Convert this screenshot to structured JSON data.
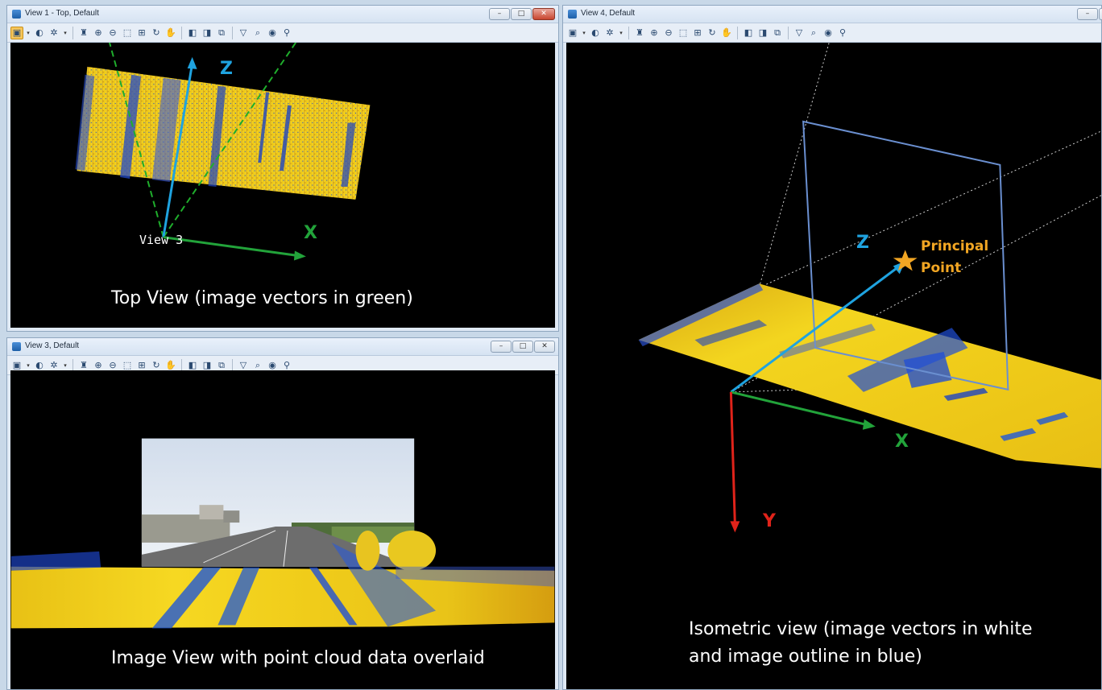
{
  "windows": {
    "view1": {
      "title": "View 1 - Top, Default"
    },
    "view3": {
      "title": "View 3, Default"
    },
    "view4": {
      "title": "View 4, Default"
    }
  },
  "window_buttons": {
    "minimize": "–",
    "maximize": "□",
    "close": "✕"
  },
  "toolbar_icons": [
    "view-groups-icon",
    "dropdown-icon",
    "display-style-icon",
    "lighting-icon",
    "dropdown-icon",
    "view-attributes-icon",
    "zoom-in-icon",
    "zoom-out-icon",
    "window-area-icon",
    "fit-view-icon",
    "rotate-view-icon",
    "pan-view-icon",
    "view-previous-icon",
    "view-next-icon",
    "copy-view-icon",
    "clip-volume-icon",
    "clip-mask-icon",
    "camera-icon",
    "walk-icon"
  ],
  "top_view": {
    "label_z": "Z",
    "label_x": "X",
    "label_view": "View 3",
    "caption": "Top View (image vectors in green)"
  },
  "image_view": {
    "caption": "Image View with point cloud data overlaid"
  },
  "iso_view": {
    "label_z": "Z",
    "label_x": "X",
    "label_y": "Y",
    "principal_point_line1": "Principal",
    "principal_point_line2": "Point",
    "caption_line1": "Isometric view (image vectors in white",
    "caption_line2": "and image outline in blue)"
  },
  "colors": {
    "axis_z": "#1fa3e0",
    "axis_x": "#22a33a",
    "axis_y": "#e0231a",
    "image_vector_top": "#1fae2c",
    "image_outline": "#6a8fd0",
    "principal_point": "#f2a623",
    "point_cloud_yellow": "#f2d21a",
    "point_cloud_blue": "#1f4fd6"
  }
}
